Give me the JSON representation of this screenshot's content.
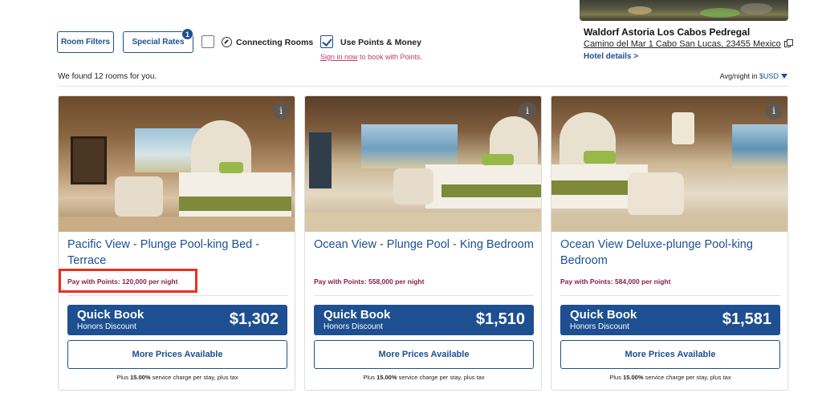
{
  "hotel": {
    "name": "Waldorf Astoria Los Cabos Pedregal",
    "address": "Camino del Mar 1 Cabo San Lucas, 23455 Mexico",
    "details_link": "Hotel details >"
  },
  "filters": {
    "room_filters": "Room Filters",
    "special_rates": "Special Rates",
    "special_rates_count": "1",
    "connecting_rooms": "Connecting Rooms",
    "connecting_rooms_checked": false,
    "use_points": "Use Points & Money",
    "use_points_checked": true,
    "signin_link": "Sign in now",
    "signin_suffix": " to book with Points."
  },
  "results": {
    "found_text": "We found 12 rooms for you.",
    "avg_label": "Avg/night in ",
    "currency": "$USD"
  },
  "rooms": [
    {
      "title": "Pacific View - Plunge Pool-king Bed - Terrace",
      "points": "Pay with Points: 120,000 per night",
      "quick_book": "Quick Book",
      "rate_type": "Honors Discount",
      "price": "$1,302",
      "more_prices": "More Prices Available",
      "charge_prefix": "Plus ",
      "charge_pct": "15.00%",
      "charge_suffix": " service charge per stay, plus tax"
    },
    {
      "title": "Ocean View - Plunge Pool - King Bedroom",
      "points": "Pay with Points: 558,000 per night",
      "quick_book": "Quick Book",
      "rate_type": "Honors Discount",
      "price": "$1,510",
      "more_prices": "More Prices Available",
      "charge_prefix": "Plus ",
      "charge_pct": "15.00%",
      "charge_suffix": " service charge per stay, plus tax"
    },
    {
      "title": "Ocean View Deluxe-plunge Pool-king Bedroom",
      "points": "Pay with Points: 584,000 per night",
      "quick_book": "Quick Book",
      "rate_type": "Honors Discount",
      "price": "$1,581",
      "more_prices": "More Prices Available",
      "charge_prefix": "Plus ",
      "charge_pct": "15.00%",
      "charge_suffix": " service charge per stay, plus tax"
    }
  ],
  "icons": {
    "info": "info-icon",
    "connecting": "connecting-rooms-icon",
    "external": "external-link-icon",
    "dropdown": "chevron-down-icon",
    "checkbox": "checkmark-icon"
  },
  "colors": {
    "brand_blue": "#1d4f91",
    "points_text": "#8b1d4a",
    "signin_text": "#c0396b",
    "highlight_box": "#e8311e"
  }
}
